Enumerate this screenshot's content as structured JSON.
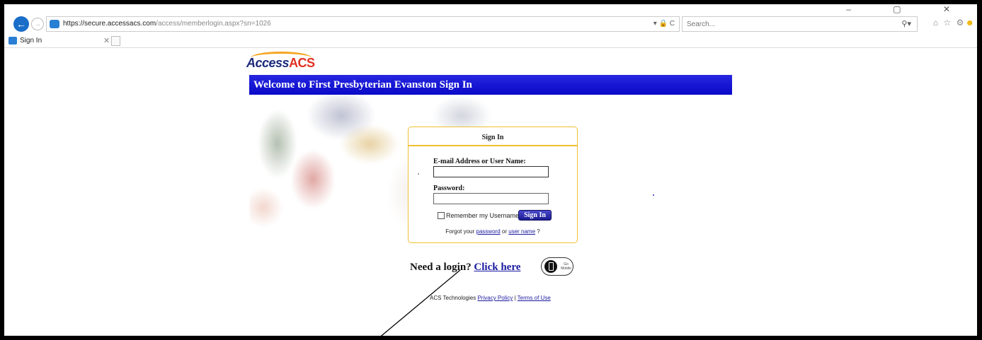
{
  "browser": {
    "url_host": "https://secure.accessacs.com",
    "url_path": "/access/memberlogin.aspx?sn=1026",
    "url_tools": "▾ 🔒 C",
    "search_placeholder": "Search...",
    "window_controls": "– ▢ ✕",
    "toolbar_icons": "⌂ ☆ ⚙",
    "smiley": "☻"
  },
  "tab": {
    "label": "Sign In",
    "close": "✕"
  },
  "page": {
    "logo_access": "Access",
    "logo_acs": "ACS",
    "welcome": "Welcome to First Presbyterian Evanston Sign In",
    "signin": {
      "title": "Sign In",
      "email_label": "E-mail Address or User Name:",
      "email_value": "",
      "password_label": "Password:",
      "password_value": "",
      "remember_label": "Remember my Username",
      "button": "Sign In",
      "forgot_prefix": "Forgot your",
      "forgot_password": "password",
      "forgot_or": "or",
      "forgot_username": "user name",
      "forgot_suffix": "?"
    },
    "need_login": "Need a login?",
    "click_here": "Click here",
    "go_mobile": "Go Mobile",
    "footer": {
      "company": "ACS Technologies",
      "privacy": "Privacy Policy",
      "separator": "|",
      "terms": "Terms of Use"
    }
  },
  "colors": {
    "banner": "#0909c8",
    "link": "#1a1aa0",
    "box_border": "#f0c030"
  }
}
